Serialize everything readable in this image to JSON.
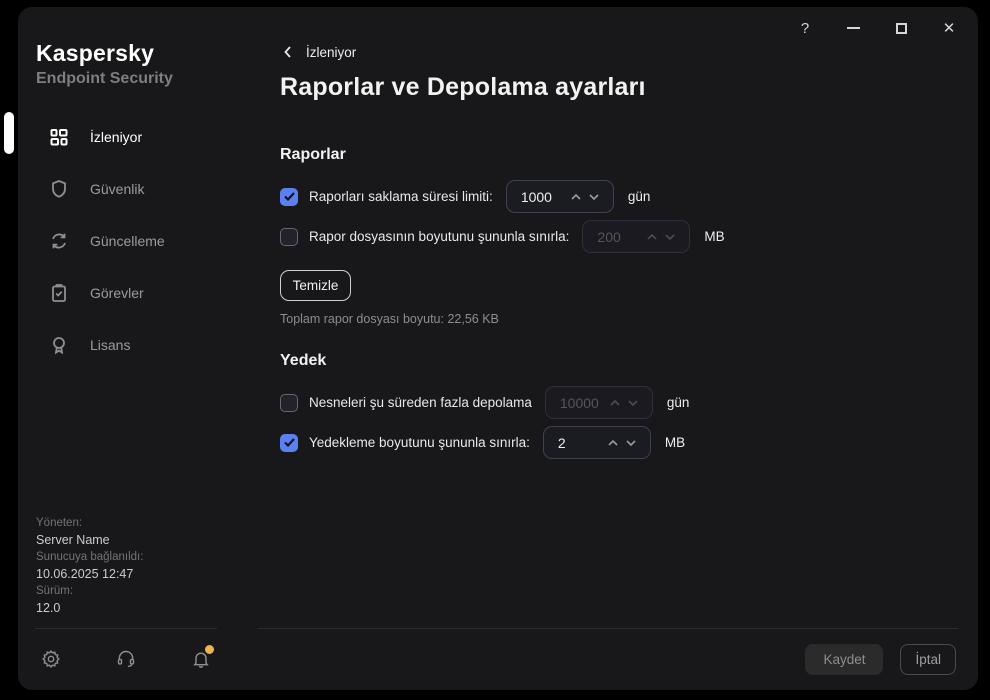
{
  "app": {
    "brand": "Kaspersky",
    "product": "Endpoint Security"
  },
  "window_controls": {
    "help_glyph": "?",
    "close_glyph": "✕"
  },
  "sidebar": {
    "items": [
      {
        "label": "İzleniyor",
        "icon": "dashboard-icon",
        "active": true
      },
      {
        "label": "Güvenlik",
        "icon": "shield-icon",
        "active": false
      },
      {
        "label": "Güncelleme",
        "icon": "refresh-icon",
        "active": false
      },
      {
        "label": "Görevler",
        "icon": "tasks-icon",
        "active": false
      },
      {
        "label": "Lisans",
        "icon": "license-icon",
        "active": false
      }
    ],
    "server_info": {
      "managed_label": "Yöneten:",
      "managed_value": "Server Name",
      "connected_label": "Sunucuya bağlanıldı:",
      "connected_value": "10.06.2025 12:47",
      "version_label": "Sürüm:",
      "version_value": "12.0"
    }
  },
  "header": {
    "breadcrumb": "İzleniyor",
    "title": "Raporlar ve Depolama ayarları"
  },
  "reports": {
    "title": "Raporlar",
    "row_retention": {
      "checked": true,
      "label": "Raporları saklama süresi limiti:",
      "value": "1000",
      "unit": "gün"
    },
    "row_filesize": {
      "checked": false,
      "label": "Rapor dosyasının boyutunu şununla sınırla:",
      "value": "200",
      "unit": "MB"
    },
    "clear_button": "Temizle",
    "total_size": "Toplam rapor dosyası boyutu: 22,56 KB"
  },
  "backup": {
    "title": "Yedek",
    "row_retention": {
      "checked": false,
      "label": "Nesneleri şu süreden fazla depolama",
      "value": "10000",
      "unit": "gün"
    },
    "row_size": {
      "checked": true,
      "label": "Yedekleme boyutunu şununla sınırla:",
      "value": "2",
      "unit": "MB"
    }
  },
  "footer": {
    "save_label": "Kaydet",
    "cancel_label": "İptal",
    "icons": [
      "gear-icon",
      "headset-icon",
      "bell-icon"
    ]
  },
  "colors": {
    "accent_checkbox": "#5c80f0",
    "notification_dot": "#ecb44e",
    "window_bg": "#18181a"
  }
}
